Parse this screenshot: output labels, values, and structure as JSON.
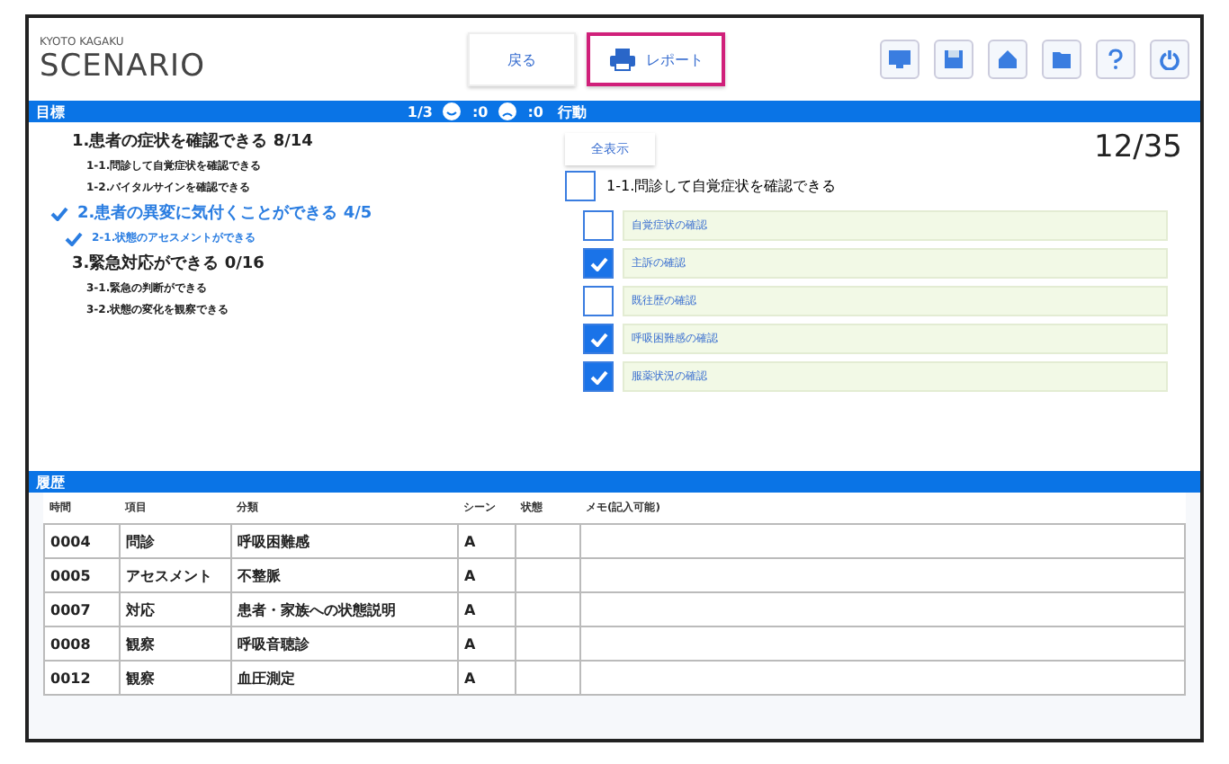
{
  "brand": {
    "company": "KYOTO KAGAKU",
    "name": "SCENARIO"
  },
  "toolbar": {
    "buttons": [
      {
        "label": "戻る",
        "highlighted": false
      },
      {
        "label": "レポート",
        "highlighted": true
      }
    ]
  },
  "goals": {
    "title": "目標",
    "progress": "1/3",
    "good_count": ":0",
    "bad_count": ":0",
    "items": [
      {
        "label": "1.患者の症状を確認できる 8/14",
        "done": false,
        "children": [
          {
            "label": "1-1.問診して自覚症状を確認できる",
            "done": false
          },
          {
            "label": "1-2.バイタルサインを確認できる",
            "done": false
          }
        ]
      },
      {
        "label": "2.患者の異変に気付くことができる 4/5",
        "done": true,
        "children": [
          {
            "label": "2-1.状態のアセスメントができる",
            "done": true
          }
        ]
      },
      {
        "label": "3.緊急対応ができる 0/16",
        "done": false,
        "children": [
          {
            "label": "3-1.緊急の判断ができる",
            "done": false
          },
          {
            "label": "3-2.状態の変化を観察できる",
            "done": false
          }
        ]
      }
    ]
  },
  "actions": {
    "title": "行動",
    "show_all": "全表示",
    "count": "12/35",
    "group": {
      "label": "1-1.問診して自覚症状を確認できる",
      "checked": false
    },
    "items": [
      {
        "label": "自覚症状の確認",
        "checked": false
      },
      {
        "label": "主訴の確認",
        "checked": true
      },
      {
        "label": "既往歴の確認",
        "checked": false
      },
      {
        "label": "呼吸困難感の確認",
        "checked": true
      },
      {
        "label": "服薬状況の確認",
        "checked": true
      }
    ]
  },
  "history": {
    "title": "履歴",
    "columns": [
      "時間",
      "項目",
      "分類",
      "シーン",
      "状態",
      "メモ(記入可能)"
    ],
    "rows": [
      [
        "0004",
        "問診",
        "呼吸困難感",
        "A",
        "",
        ""
      ],
      [
        "0005",
        "アセスメント",
        "不整脈",
        "A",
        "",
        ""
      ],
      [
        "0007",
        "対応",
        "患者・家族への状態説明",
        "A",
        "",
        ""
      ],
      [
        "0008",
        "観察",
        "呼吸音聴診",
        "A",
        "",
        ""
      ],
      [
        "0012",
        "観察",
        "血圧測定",
        "A",
        "",
        ""
      ]
    ]
  }
}
